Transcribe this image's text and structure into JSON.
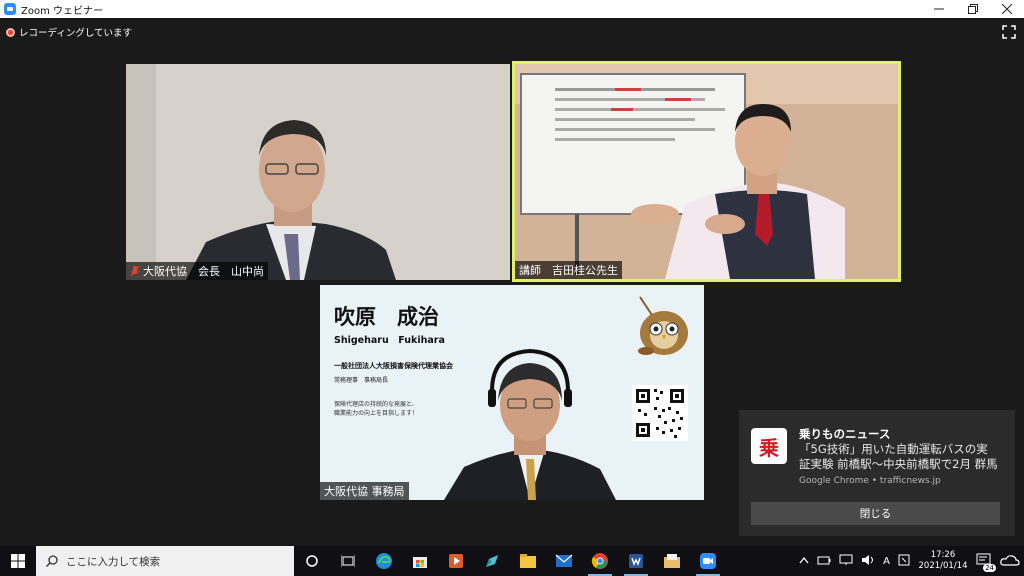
{
  "window": {
    "title": "Zoom ウェビナー"
  },
  "recording": {
    "label": "レコーディングしています"
  },
  "tiles": [
    {
      "name": "大阪代協　会長　山中尚",
      "muted": true
    },
    {
      "name": "講師　吉田桂公先生",
      "muted": false,
      "active_speaker": true
    },
    {
      "name": "大阪代協 事務局",
      "muted": false
    }
  ],
  "slide_card": {
    "name_jp": "吹原　成治",
    "name_en": "Shigeharu　Fukihara",
    "org": "一般社団法人大阪損害保険代理業協会",
    "role": "常務理事　事務局長",
    "message_line1": "保険代理店の持続的な発展と、",
    "message_line2": "職業能力の向上を目指します！"
  },
  "notification": {
    "icon_char": "乗",
    "title": "乗りものニュース",
    "body": "「5G技術」用いた自動運転バスの実証実験 前橋駅～中央前橋駅で2月 群馬",
    "source": "Google Chrome • trafficnews.jp",
    "close_label": "閉じる"
  },
  "taskbar": {
    "search_placeholder": "ここに入力して検索",
    "ime": "A",
    "time": "17:26",
    "date": "2021/01/14",
    "notification_count": "24"
  },
  "colors": {
    "active_speaker_border": "#dff06a",
    "record_red": "#e8412c",
    "zoom_blue": "#2d8cff"
  }
}
